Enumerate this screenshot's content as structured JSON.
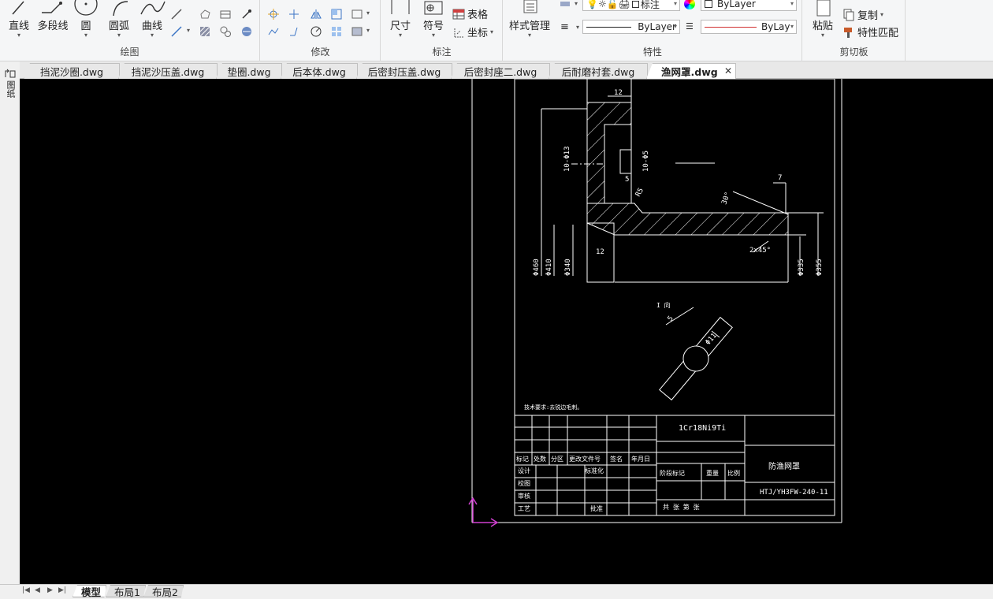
{
  "ribbon": {
    "draw": {
      "title": "绘图",
      "line": "直线",
      "polyline": "多段线",
      "circle": "圆",
      "arc": "圆弧",
      "spline": "曲线"
    },
    "modify": {
      "title": "修改"
    },
    "annotate": {
      "title": "标注",
      "dimension": "尺寸",
      "symbol": "符号",
      "table": "表格",
      "coordinate": "坐标"
    },
    "properties": {
      "title": "特性",
      "style_manager": "样式管理",
      "layer_name": "标注",
      "color": "ByLayer",
      "linetype": "ByLayer",
      "lineweight": "ByLay"
    },
    "clipboard": {
      "title": "剪切板",
      "paste": "粘贴",
      "copy": "复制",
      "match_properties": "特性匹配"
    }
  },
  "tabs": [
    {
      "label": "挡泥沙圈.dwg"
    },
    {
      "label": "挡泥沙压盖.dwg"
    },
    {
      "label": "垫圈.dwg"
    },
    {
      "label": "后本体.dwg"
    },
    {
      "label": "后密封压盖.dwg"
    },
    {
      "label": "后密封座二.dwg"
    },
    {
      "label": "后耐磨衬套.dwg"
    },
    {
      "label": "渔网罩.dwg",
      "active": true
    }
  ],
  "sidebar": {
    "label": "图纸"
  },
  "layout_tabs": [
    {
      "label": "模型",
      "active": true
    },
    {
      "label": "布局1"
    },
    {
      "label": "布局2"
    }
  ],
  "drawing": {
    "dims": {
      "d12_top": "12",
      "d12_bot": "12",
      "d_phi13": "10-Φ13",
      "d_phi5": "10-Φ5",
      "d5": "5",
      "r15": "R5",
      "d7": "7",
      "angle30": "30°",
      "chamfer": "2x45°",
      "phi460": "Φ460",
      "phi410": "Φ410",
      "phi340": "Φ340",
      "phi335": "Φ335",
      "phi355": "Φ355",
      "detail_a": "I 向",
      "detail_5": "5",
      "detail_phi11": "Φ11",
      "tech_req": "技术要求:去锐边毛刺。"
    },
    "title_block": {
      "material": "1Cr18Ni9Ti",
      "part_name": "防渔网罩",
      "drawing_no": "HTJ/YH3FW-240-11",
      "h_mark": "标记",
      "h_count": "处数",
      "h_zone": "分区",
      "h_change": "更改文件号",
      "h_sign": "签名",
      "h_date": "年月日",
      "r_design": "设计",
      "r_standard": "标准化",
      "r_check": "校图",
      "r_review": "审核",
      "r_process": "工艺",
      "r_approve": "批准",
      "stage": "阶段标记",
      "weight": "重量",
      "scale": "比例",
      "total": "共   张   第   张"
    }
  }
}
